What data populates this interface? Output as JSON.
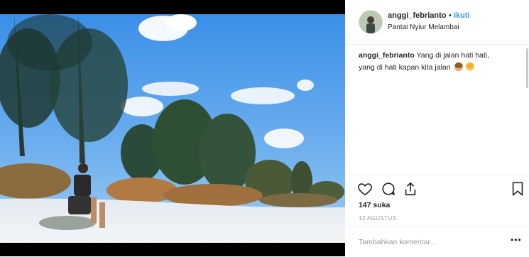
{
  "post": {
    "username": "anggi_febrianto",
    "separator": "•",
    "follow_label": "Ikuti",
    "location": "Pantai Nyiur Melambai",
    "caption_user": "anggi_febrianto",
    "caption_text_line1": "Yang di jalan hati hati,",
    "caption_text_line2": "yang di hati kapan kita jalan",
    "likes": "147 suka",
    "date": "12 AGUSTUS",
    "comment_placeholder": "Tambahkan komentar...",
    "more_label": "•••"
  },
  "icons": {
    "like": "heart-icon",
    "comment": "comment-icon",
    "share": "share-icon",
    "save": "bookmark-icon",
    "emoji1": "see-no-evil-monkey-emoji",
    "emoji2": "weary-cat-emoji"
  },
  "colors": {
    "accent": "#3897f0",
    "text": "#262626",
    "muted": "#999999",
    "border": "#efefef"
  }
}
